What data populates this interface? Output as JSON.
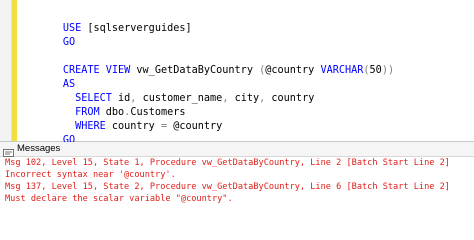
{
  "editor": {
    "lines": [
      {
        "kw1": "USE",
        "rest": " [sqlserverguides]"
      },
      {
        "kw1": "GO"
      },
      {
        "blank": ""
      },
      {
        "kw1": "CREATE VIEW",
        "rest": " vw_GetDataByCountry ",
        "paren_open": "(",
        "param": "@country",
        "type": " VARCHAR",
        "type_open": "(",
        "num": "50",
        "paren_close": "))"
      },
      {
        "kw1": "AS"
      },
      {
        "kw1": "  SELECT",
        "rest": " id",
        "c1": ",",
        "rest2": " customer_name",
        "c2": ",",
        "rest3": " city",
        "c3": ",",
        "rest4": " country"
      },
      {
        "kw1": "  FROM",
        "rest": " dbo",
        "dot": ".",
        "rest2": "Customers"
      },
      {
        "kw1": "  WHERE",
        "rest": " country ",
        "eq": "=",
        "rest2": " @country"
      },
      {
        "kw1": "GO"
      }
    ]
  },
  "messages_panel": {
    "tab_label": "Messages",
    "icon": "messages-icon",
    "lines": [
      "Msg 102, Level 15, State 1, Procedure vw_GetDataByCountry, Line 2 [Batch Start Line 2]",
      "Incorrect syntax near '@country'.",
      "Msg 137, Level 15, State 2, Procedure vw_GetDataByCountry, Line 6 [Batch Start Line 2]",
      "Must declare the scalar variable \"@country\"."
    ],
    "error_color": "#e0201b"
  },
  "colors": {
    "keyword": "#0000ff",
    "operator": "#808080",
    "change_bar": "#f0e040"
  }
}
